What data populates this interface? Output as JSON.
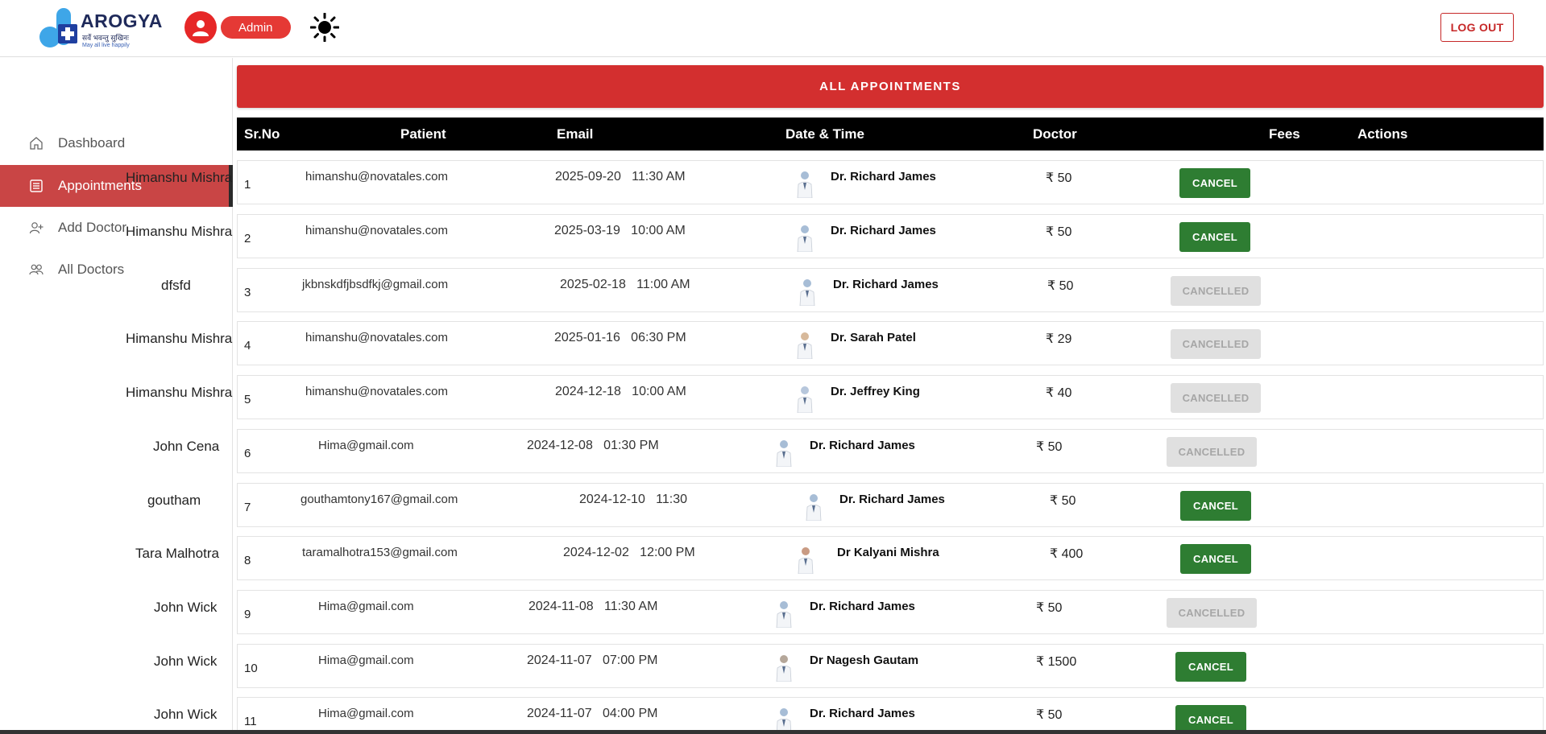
{
  "brand": {
    "name": "AROGYA",
    "tagline_hindi": "सर्वे भवन्तु सुखिनः",
    "tagline_english": "May all live happily"
  },
  "header": {
    "role_label": "Admin",
    "logout_label": "LOG OUT"
  },
  "sidebar": {
    "items": [
      {
        "label": "Dashboard",
        "icon": "home-icon",
        "active": false
      },
      {
        "label": "Appointments",
        "icon": "list-icon",
        "active": true
      },
      {
        "label": "Add Doctor",
        "icon": "add-user-icon",
        "active": false
      },
      {
        "label": "All Doctors",
        "icon": "users-icon",
        "active": false
      }
    ]
  },
  "main": {
    "title": "ALL APPOINTMENTS",
    "columns": [
      "Sr.No",
      "Patient",
      "Email",
      "Date & Time",
      "Doctor",
      "Fees",
      "Actions"
    ],
    "rows": [
      {
        "sr": "1",
        "patient": "Himanshu Mishra",
        "email": "himanshu@novatales.com",
        "datetime": "2025-09-20   11:30 AM",
        "doctor": "Dr. Richard James",
        "fee": "₹ 50",
        "action": "CANCEL",
        "status": "active"
      },
      {
        "sr": "2",
        "patient": "Himanshu Mishra",
        "email": "himanshu@novatales.com",
        "datetime": "2025-03-19   10:00 AM",
        "doctor": "Dr. Richard James",
        "fee": "₹ 50",
        "action": "CANCEL",
        "status": "active"
      },
      {
        "sr": "3",
        "patient": "dfsfd",
        "email": "jkbnskdfjbsdfkj@gmail.com",
        "datetime": "2025-02-18   11:00 AM",
        "doctor": "Dr. Richard James",
        "fee": "₹ 50",
        "action": "CANCELLED",
        "status": "cancelled"
      },
      {
        "sr": "4",
        "patient": "Himanshu Mishra",
        "email": "himanshu@novatales.com",
        "datetime": "2025-01-16   06:30 PM",
        "doctor": "Dr. Sarah Patel",
        "fee": "₹ 29",
        "action": "CANCELLED",
        "status": "cancelled"
      },
      {
        "sr": "5",
        "patient": "Himanshu Mishra",
        "email": "himanshu@novatales.com",
        "datetime": "2024-12-18   10:00 AM",
        "doctor": "Dr. Jeffrey King",
        "fee": "₹ 40",
        "action": "CANCELLED",
        "status": "cancelled"
      },
      {
        "sr": "6",
        "patient": "John Cena",
        "email": "Hima@gmail.com",
        "datetime": "2024-12-08   01:30 PM",
        "doctor": "Dr. Richard James",
        "fee": "₹ 50",
        "action": "CANCELLED",
        "status": "cancelled"
      },
      {
        "sr": "7",
        "patient": "goutham",
        "email": "gouthamtony167@gmail.com",
        "datetime": "2024-12-10   11:30",
        "doctor": "Dr. Richard James",
        "fee": "₹ 50",
        "action": "CANCEL",
        "status": "active"
      },
      {
        "sr": "8",
        "patient": "Tara Malhotra",
        "email": "taramalhotra153@gmail.com",
        "datetime": "2024-12-02   12:00 PM",
        "doctor": "Dr Kalyani Mishra",
        "fee": "₹ 400",
        "action": "CANCEL",
        "status": "active"
      },
      {
        "sr": "9",
        "patient": "John Wick",
        "email": "Hima@gmail.com",
        "datetime": "2024-11-08   11:30 AM",
        "doctor": "Dr. Richard James",
        "fee": "₹ 50",
        "action": "CANCELLED",
        "status": "cancelled"
      },
      {
        "sr": "10",
        "patient": "John Wick",
        "email": "Hima@gmail.com",
        "datetime": "2024-11-07   07:00 PM",
        "doctor": "Dr Nagesh Gautam",
        "fee": "₹ 1500",
        "action": "CANCEL",
        "status": "active"
      },
      {
        "sr": "11",
        "patient": "John Wick",
        "email": "Hima@gmail.com",
        "datetime": "2024-11-07   04:00 PM",
        "doctor": "Dr. Richard James",
        "fee": "₹ 50",
        "action": "CANCEL",
        "status": "active"
      }
    ]
  },
  "colors": {
    "brand_red": "#d32f2f",
    "active_nav": "#c94545",
    "cancel_green": "#2e7d32",
    "cancelled_gray": "#e0e0e0"
  }
}
